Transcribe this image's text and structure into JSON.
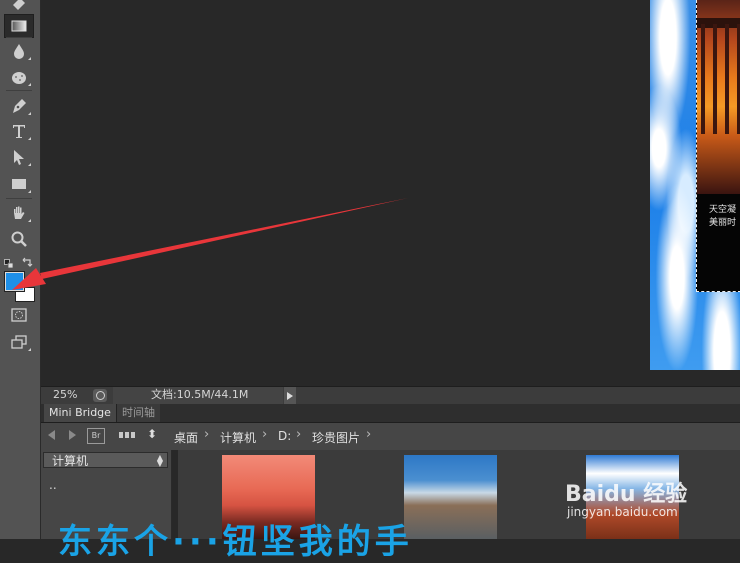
{
  "status_bar": {
    "zoom": "25%",
    "doc_info": "文档:10.5M/44.1M"
  },
  "panel": {
    "tabs": [
      "Mini Bridge",
      "时间轴"
    ]
  },
  "bridge": {
    "br_label": "Br",
    "breadcrumb": [
      "桌面",
      "计算机",
      "D:",
      "珍贵图片"
    ],
    "folder_select": "计算机",
    "parent_dir": ".."
  },
  "document": {
    "caption_line1": "天空凝",
    "caption_line2": "美丽时"
  },
  "overlay": {
    "watermark": "Baidu 经验",
    "watermark_url": "jingyan.baidu.com",
    "bottom_text": "东东个···钮坚我的手"
  },
  "colors": {
    "foreground": "#1e8fe8",
    "background": "#ffffff",
    "arrow": "#e8363a"
  },
  "icons": [
    "eraser-icon",
    "gradient-icon",
    "blur-drop-icon",
    "sponge-icon",
    "pen-icon",
    "type-icon",
    "path-select-icon",
    "rectangle-icon",
    "hand-icon",
    "zoom-icon",
    "default-colors-icon",
    "swap-colors-icon",
    "quick-mask-icon",
    "screen-mode-icon"
  ]
}
